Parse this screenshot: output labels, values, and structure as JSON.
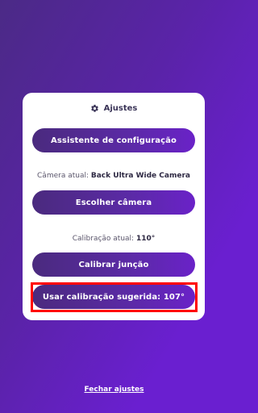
{
  "settings_card": {
    "title": "Ajustes",
    "title_icon": "gear-icon",
    "setup_assistant_button": "Assistente de configuração",
    "current_camera_label": "Câmera atual:",
    "current_camera_value": "Back Ultra Wide Camera",
    "choose_camera_button": "Escolher câmera",
    "current_calibration_label": "Calibração atual:",
    "current_calibration_value": "110°",
    "calibrate_junction_button": "Calibrar junção",
    "use_suggested_calibration_button": "Usar calibração sugerida: 107°"
  },
  "footer": {
    "close_settings_link": "Fechar ajustes"
  },
  "colors": {
    "background_start": "#4b2a86",
    "background_end": "#6a1fd0",
    "button_gradient_start": "#4a2a7e",
    "button_gradient_end": "#6a22c8",
    "highlight": "#ff0000"
  }
}
